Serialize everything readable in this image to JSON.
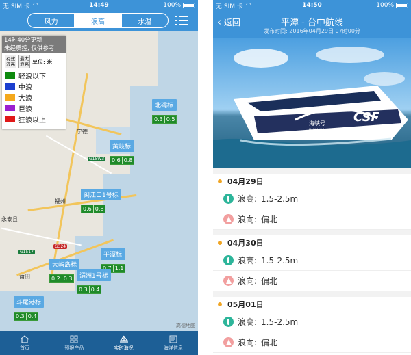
{
  "left": {
    "status": {
      "carrier": "无 SIM 卡",
      "time": "14:49",
      "battery": "100%"
    },
    "segments": [
      {
        "label": "风力",
        "active": false
      },
      {
        "label": "浪高",
        "active": true
      },
      {
        "label": "水温",
        "active": false
      }
    ],
    "legend": {
      "update_line1": "14时40分更新",
      "update_line2": "未经质控, 仅供参考",
      "btn_valid": "有效\n浪高",
      "btn_max": "最大\n浪高",
      "unit": "单位: 米",
      "items": [
        {
          "label": "轻浪以下",
          "color": "#0e8a0e"
        },
        {
          "label": "中浪",
          "color": "#1c3fcf"
        },
        {
          "label": "大浪",
          "color": "#f4a81c"
        },
        {
          "label": "巨浪",
          "color": "#9b1fcf"
        },
        {
          "label": "狂浪以上",
          "color": "#e01818"
        }
      ]
    },
    "buoys": [
      {
        "name": "北礵标",
        "a": "0.3",
        "b": "0.5"
      },
      {
        "name": "黄岐标",
        "a": "0.6",
        "b": "0.8"
      },
      {
        "name": "闽江口1号标",
        "a": "0.6",
        "b": "0.8"
      },
      {
        "name": "平潭标",
        "a": "0.7",
        "b": "1.1"
      },
      {
        "name": "大屿岛标",
        "a": "0.2",
        "b": "0.3"
      },
      {
        "name": "湄洲1号标",
        "a": "0.3",
        "b": "0.4"
      },
      {
        "name": "斗尾港标",
        "a": "0.3",
        "b": "0.4"
      }
    ],
    "cities": {
      "ningde": "宁德",
      "fuzhou": "福州",
      "putian": "莆田",
      "yongtai": "永泰县"
    },
    "shields": {
      "g15w3": "G15W3",
      "g324": "G324",
      "g1517": "G1517"
    },
    "watermark": "高德地图",
    "tabs": [
      {
        "label": "首页",
        "active": false
      },
      {
        "label": "预报产品",
        "active": false
      },
      {
        "label": "实时海况",
        "active": true
      },
      {
        "label": "海洋信息",
        "active": false
      }
    ]
  },
  "right": {
    "status": {
      "carrier": "无 SIM 卡",
      "time": "14:50",
      "battery": "100%"
    },
    "back": "返回",
    "title": "平潭 - 台中航线",
    "published": "发布时间: 2016年04月29日 07时00分",
    "days": [
      {
        "date": "04月29日",
        "height_label": "浪高:",
        "height": "1.5-2.5m",
        "dir_label": "浪向:",
        "dir": "偏北"
      },
      {
        "date": "04月30日",
        "height_label": "浪高:",
        "height": "1.5-2.5m",
        "dir_label": "浪向:",
        "dir": "偏北"
      },
      {
        "date": "05月01日",
        "height_label": "浪高:",
        "height": "1.5-2.5m",
        "dir_label": "浪向:",
        "dir": "偏北"
      }
    ],
    "ship": {
      "brand": "CSF",
      "name": "海峡号",
      "sub": "HAIXIAHAO"
    }
  }
}
